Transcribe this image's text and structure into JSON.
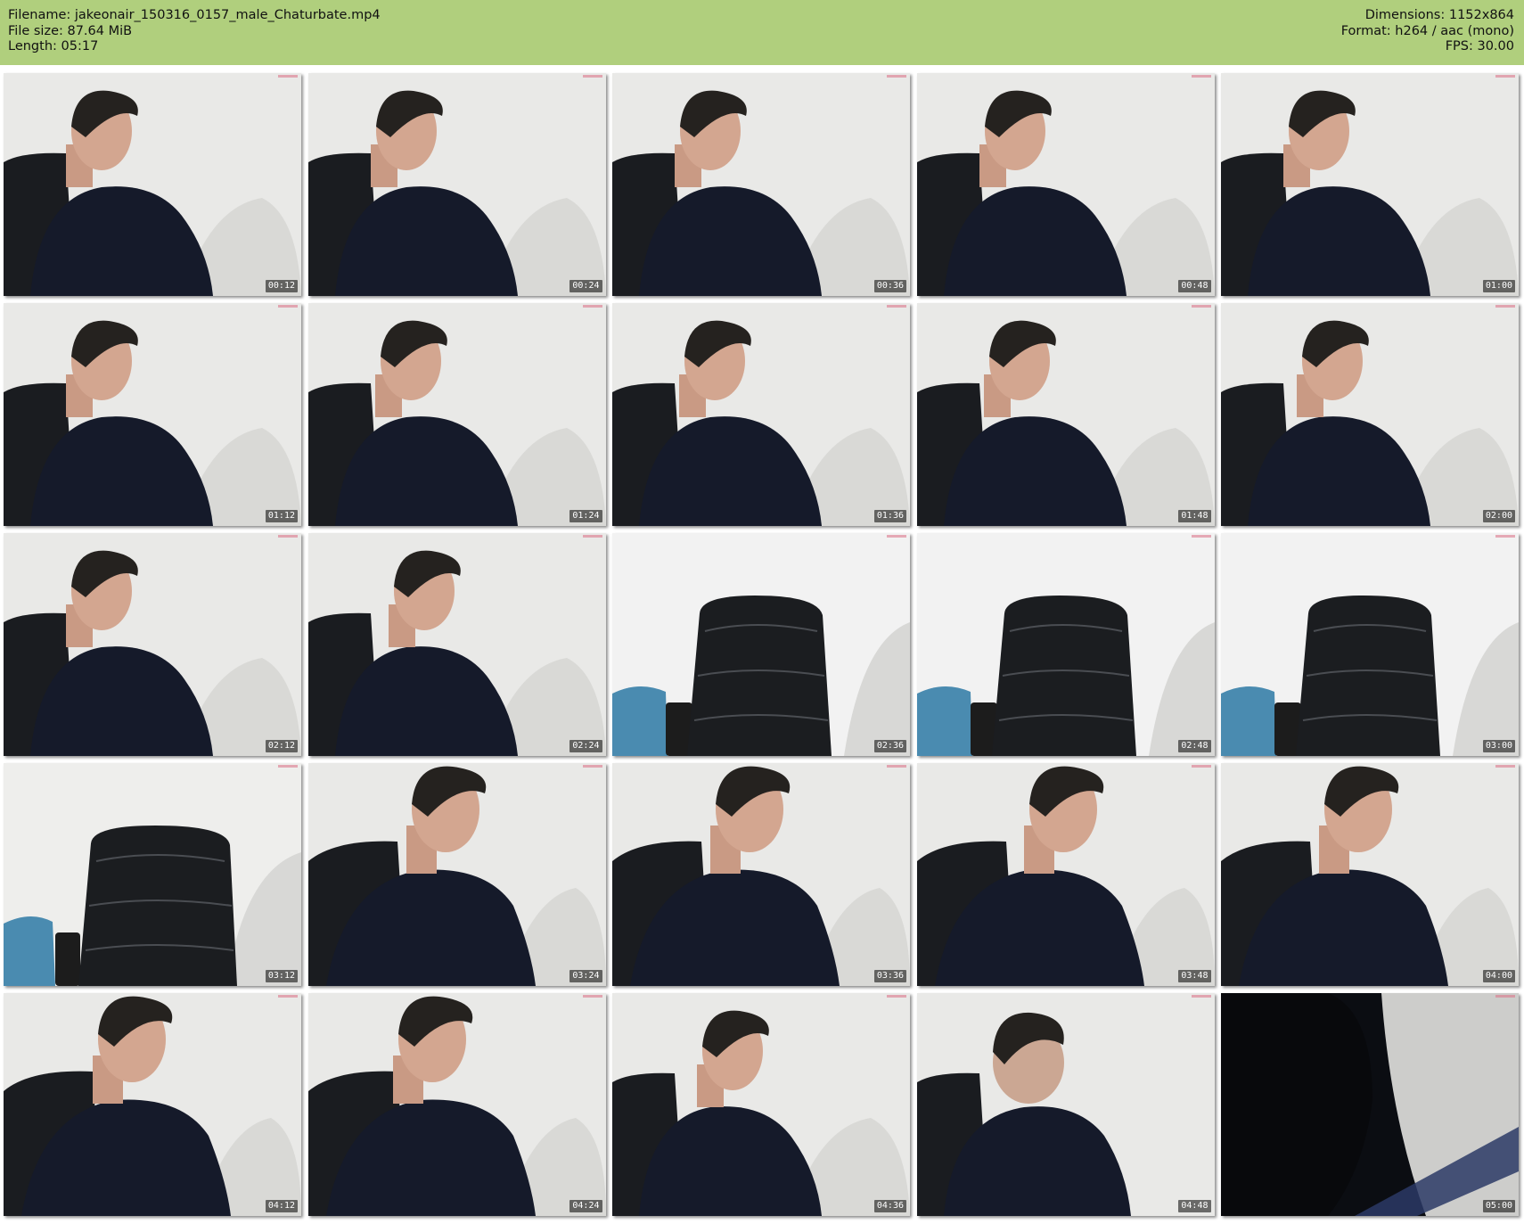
{
  "header": {
    "left": [
      "Filename: jakeonair_150316_0157_male_Chaturbate.mp4",
      "File size: 87.64 MiB",
      "Length: 05:17"
    ],
    "right": [
      "Dimensions: 1152x864",
      "Format: h264 / aac (mono)",
      "FPS: 30.00"
    ],
    "background": "#b0cf7d"
  },
  "thumbnails": [
    {
      "time": "00:12",
      "scene": "person-left"
    },
    {
      "time": "00:24",
      "scene": "person"
    },
    {
      "time": "00:36",
      "scene": "person"
    },
    {
      "time": "00:48",
      "scene": "person"
    },
    {
      "time": "01:00",
      "scene": "person"
    },
    {
      "time": "01:12",
      "scene": "person-left"
    },
    {
      "time": "01:24",
      "scene": "person"
    },
    {
      "time": "01:36",
      "scene": "person"
    },
    {
      "time": "01:48",
      "scene": "person"
    },
    {
      "time": "02:00",
      "scene": "person"
    },
    {
      "time": "02:12",
      "scene": "person-left"
    },
    {
      "time": "02:24",
      "scene": "person"
    },
    {
      "time": "02:36",
      "scene": "empty-chair"
    },
    {
      "time": "02:48",
      "scene": "empty-chair"
    },
    {
      "time": "03:00",
      "scene": "empty-chair"
    },
    {
      "time": "03:12",
      "scene": "empty-chair-left"
    },
    {
      "time": "03:24",
      "scene": "person-close"
    },
    {
      "time": "03:36",
      "scene": "person-close"
    },
    {
      "time": "03:48",
      "scene": "person-close"
    },
    {
      "time": "04:00",
      "scene": "person-close"
    },
    {
      "time": "04:12",
      "scene": "person-close"
    },
    {
      "time": "04:24",
      "scene": "person-close"
    },
    {
      "time": "04:36",
      "scene": "person"
    },
    {
      "time": "04:48",
      "scene": "person-blur"
    },
    {
      "time": "05:00",
      "scene": "dark-blur"
    }
  ]
}
